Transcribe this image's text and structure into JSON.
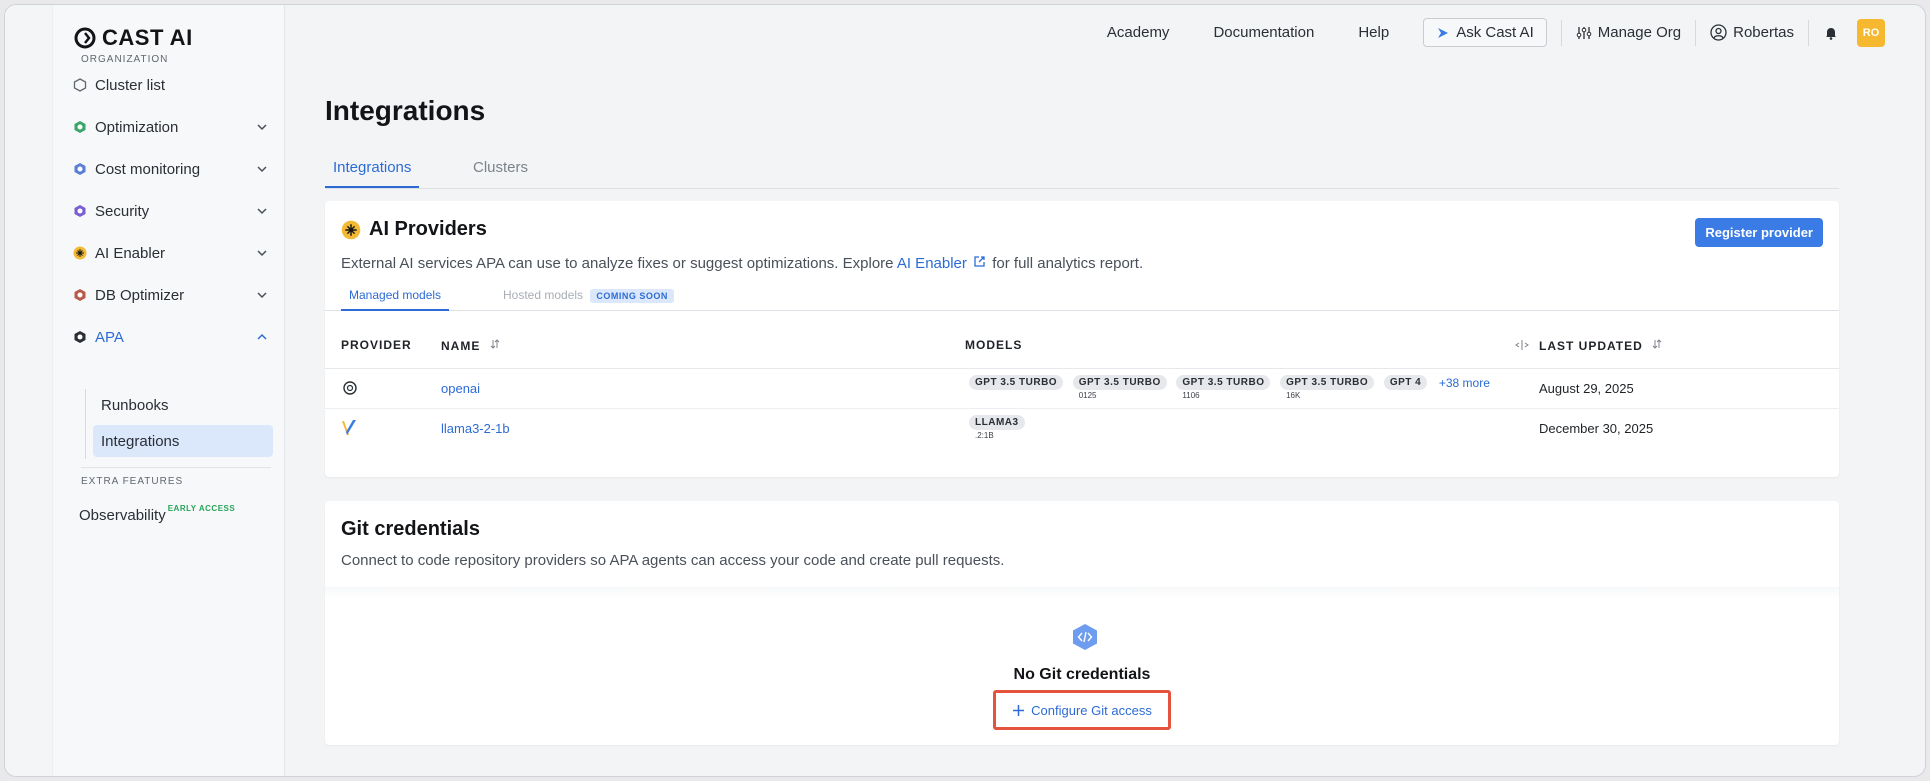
{
  "brand": {
    "name": "CAST AI"
  },
  "sidebar": {
    "org_label": "ORGANIZATION",
    "items": [
      {
        "label": "Cluster list"
      },
      {
        "label": "Optimization"
      },
      {
        "label": "Cost monitoring"
      },
      {
        "label": "Security"
      },
      {
        "label": "AI Enabler"
      },
      {
        "label": "DB Optimizer"
      },
      {
        "label": "APA"
      }
    ],
    "apa_sub": [
      {
        "label": "Runbooks"
      },
      {
        "label": "Integrations"
      }
    ],
    "extra_label": "EXTRA FEATURES",
    "observability": "Observability",
    "early_access": "EARLY ACCESS"
  },
  "topnav": {
    "academy": "Academy",
    "documentation": "Documentation",
    "help": "Help",
    "ask": "Ask Cast AI",
    "manage_org": "Manage Org",
    "user": "Robertas",
    "avatar": "RO"
  },
  "page": {
    "title": "Integrations",
    "tabs": [
      {
        "label": "Integrations"
      },
      {
        "label": "Clusters"
      }
    ]
  },
  "ai_providers": {
    "title": "AI Providers",
    "desc_pre": "External AI services APA can use to analyze fixes or suggest optimizations. Explore ",
    "desc_link": "AI Enabler",
    "desc_post": " for full analytics report.",
    "register": "Register provider",
    "subtabs": {
      "managed": "Managed models",
      "hosted": "Hosted models",
      "coming_soon": "COMING SOON"
    },
    "columns": {
      "provider": "PROVIDER",
      "name": "NAME",
      "models": "MODELS",
      "updated": "LAST UPDATED"
    },
    "rows": [
      {
        "name": "openai",
        "models": [
          {
            "label": "GPT 3.5 TURBO",
            "sub": ""
          },
          {
            "label": "GPT 3.5 TURBO",
            "sub": "0125"
          },
          {
            "label": "GPT 3.5 TURBO",
            "sub": "1106"
          },
          {
            "label": "GPT 3.5 TURBO",
            "sub": "16K"
          },
          {
            "label": "GPT 4",
            "sub": ""
          }
        ],
        "more": "+38 more",
        "updated": "August 29, 2025"
      },
      {
        "name": "llama3-2-1b",
        "models": [
          {
            "label": "LLAMA3",
            "sub": ".2:1B"
          }
        ],
        "updated": "December 30, 2025"
      }
    ]
  },
  "git": {
    "title": "Git credentials",
    "desc": "Connect to code repository providers so APA agents can access your code and create pull requests.",
    "empty_title": "No Git credentials",
    "configure": "Configure Git access"
  }
}
